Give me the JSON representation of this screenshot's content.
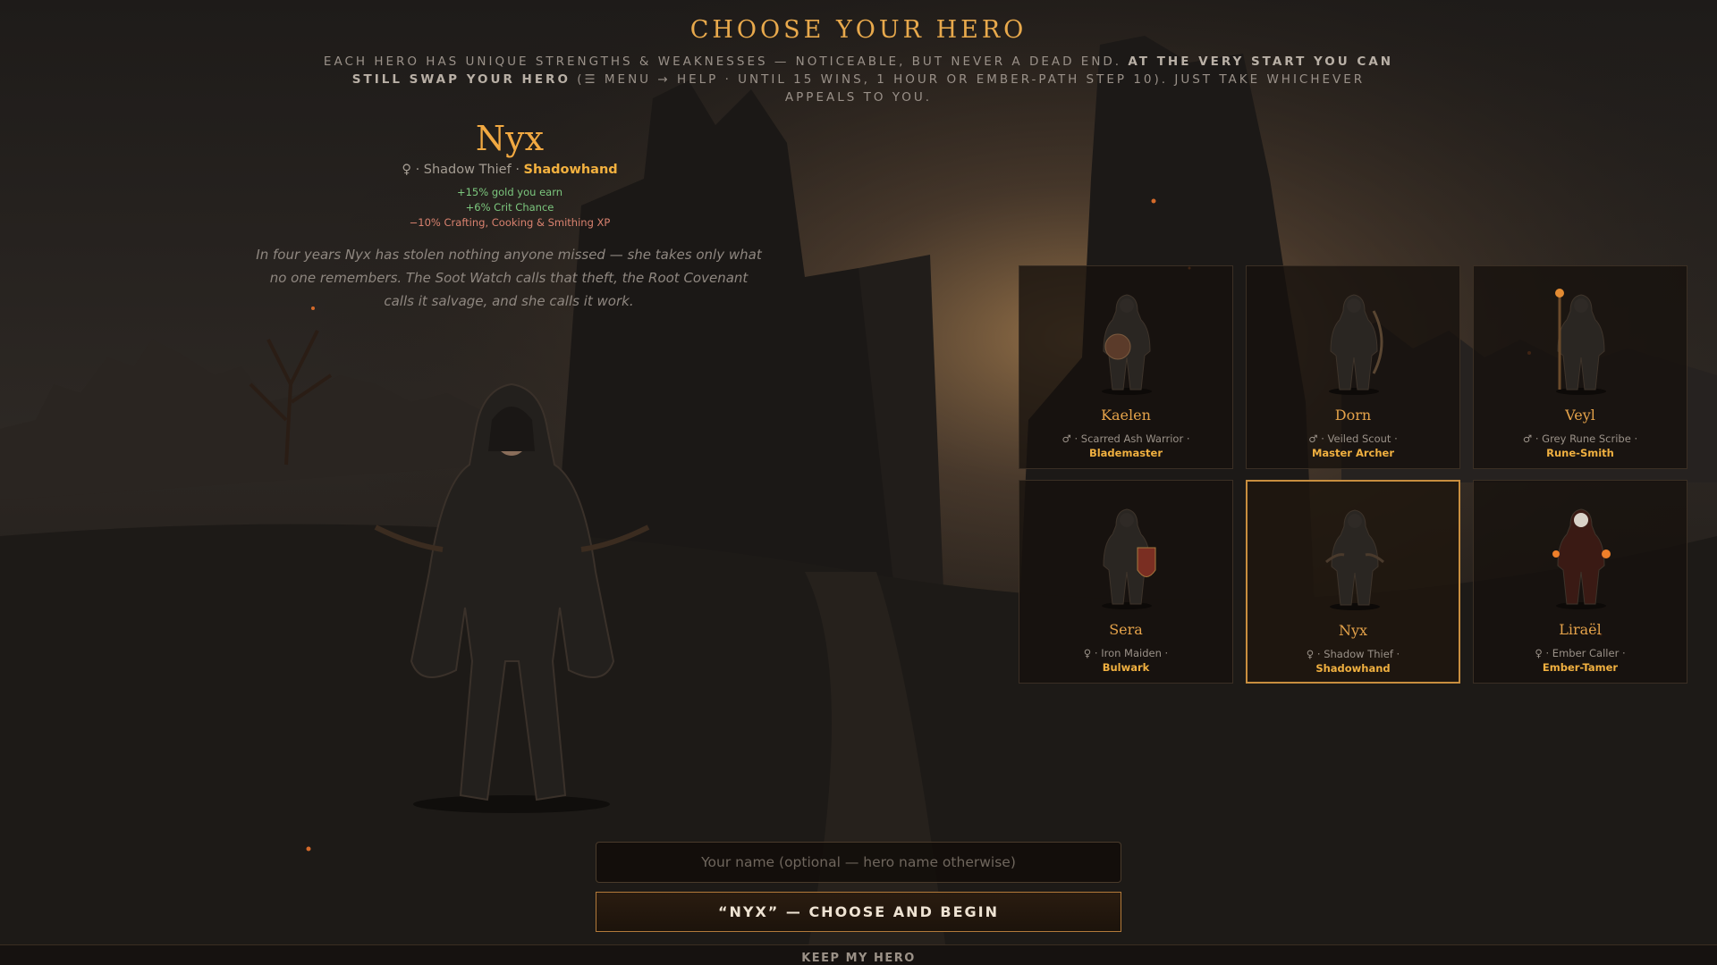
{
  "screen": {
    "title": "CHOOSE YOUR HERO",
    "intro_plain": "EACH HERO HAS UNIQUE STRENGTHS & WEAKNESSES — NOTICEABLE, BUT NEVER A DEAD END. ",
    "intro_bold": "AT THE VERY START YOU CAN STILL SWAP YOUR HERO",
    "intro_tail": " (☰ MENU → HELP · UNTIL 15 WINS, 1 HOUR OR EMBER-PATH STEP 10). JUST TAKE WHICHEVER APPEALS TO YOU."
  },
  "colors": {
    "accent": "#e8a94c",
    "positive": "#7cc77e",
    "negative": "#d9826f",
    "selected_border": "#c88e3f"
  },
  "selected_hero": {
    "name": "Nyx",
    "gender_icon": "female-symbol-icon",
    "gender_glyph": "♀",
    "class": "Shadow Thief",
    "spec": "Shadowhand",
    "mods": {
      "plus1": "+15% gold you earn",
      "plus2": "+6% Crit Chance",
      "minus1": "−10% Crafting, Cooking & Smithing XP"
    },
    "story": "In four years Nyx has stolen nothing anyone missed — she takes only what no one remembers. The Soot Watch calls that theft, the Root Covenant calls it salvage, and she calls it work."
  },
  "heroes": [
    {
      "name": "Kaelen",
      "gender_glyph": "♂",
      "class": "Scarred Ash Warrior",
      "spec": "Blademaster",
      "icon": "warrior-figure-icon"
    },
    {
      "name": "Dorn",
      "gender_glyph": "♂",
      "class": "Veiled Scout",
      "spec": "Master Archer",
      "icon": "archer-figure-icon"
    },
    {
      "name": "Veyl",
      "gender_glyph": "♂",
      "class": "Grey Rune Scribe",
      "spec": "Rune-Smith",
      "icon": "mage-figure-icon"
    },
    {
      "name": "Sera",
      "gender_glyph": "♀",
      "class": "Iron Maiden",
      "spec": "Bulwark",
      "icon": "shield-maiden-figure-icon"
    },
    {
      "name": "Nyx",
      "gender_glyph": "♀",
      "class": "Shadow Thief",
      "spec": "Shadowhand",
      "icon": "thief-figure-icon",
      "selected": true
    },
    {
      "name": "Liraël",
      "gender_glyph": "♀",
      "class": "Ember Caller",
      "spec": "Ember-Tamer",
      "icon": "ember-caller-figure-icon"
    }
  ],
  "form": {
    "name_placeholder": "Your name (optional — hero name otherwise)",
    "name_value": "",
    "begin_label": "“NYX” — CHOOSE AND BEGIN",
    "keep_label": "KEEP MY HERO"
  }
}
